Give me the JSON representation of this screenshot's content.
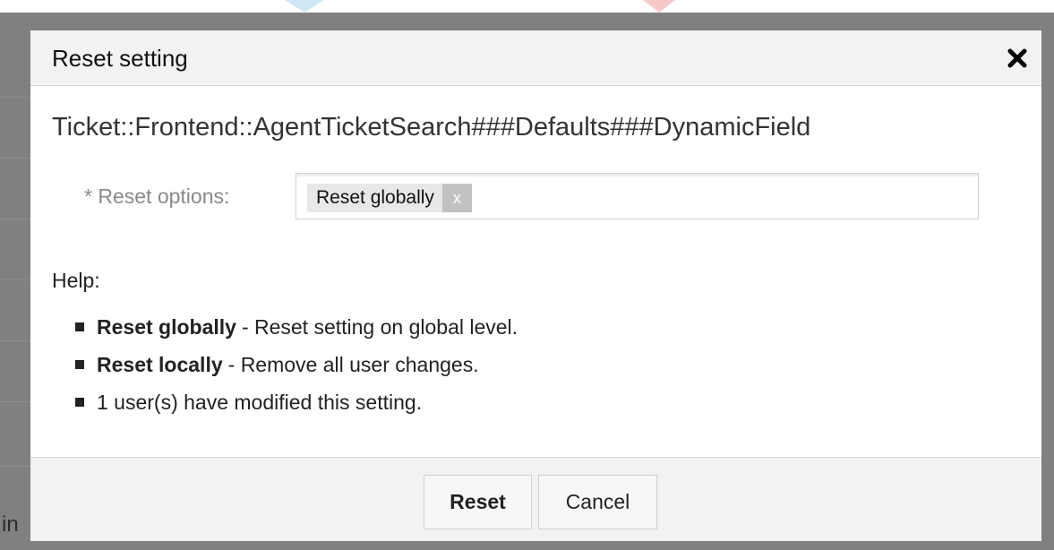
{
  "dialog": {
    "title": "Reset setting",
    "close_icon": "close-icon",
    "setting_name": "Ticket::Frontend::AgentTicketSearch###Defaults###DynamicField",
    "reset_options_label": "* Reset options:",
    "selected_option": "Reset globally",
    "selected_option_remove": "x",
    "help_label": "Help:",
    "help_items": [
      {
        "bold": "Reset globally",
        "text": "- Reset setting on global level."
      },
      {
        "bold": "Reset locally",
        "text": "- Remove all user changes."
      },
      {
        "bold": "",
        "text": "1 user(s) have modified this setting."
      }
    ],
    "buttons": {
      "reset": "Reset",
      "cancel": "Cancel"
    }
  },
  "background": {
    "partial_text": "in"
  },
  "colors": {
    "header_bg": "#f2f2f2",
    "overlay": "#808080"
  }
}
